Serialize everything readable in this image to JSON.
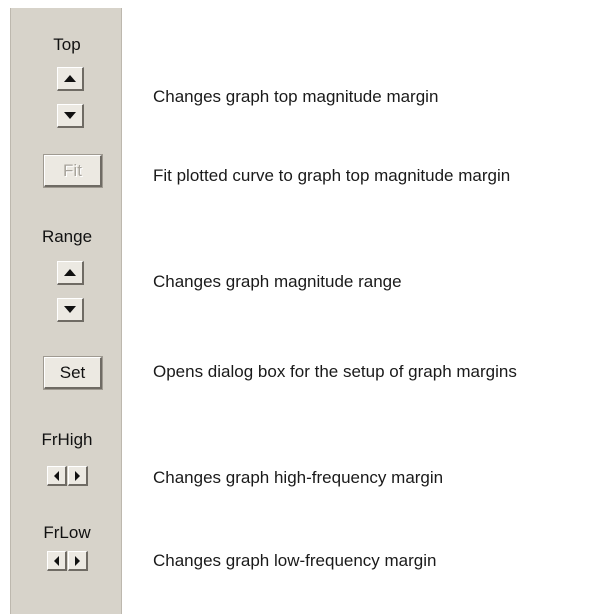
{
  "panel": {
    "top_label": "Top",
    "fit_label": "Fit",
    "range_label": "Range",
    "set_label": "Set",
    "frhigh_label": "FrHigh",
    "frlow_label": "FrLow"
  },
  "descriptions": {
    "top": "Changes graph top magnitude margin",
    "fit": "Fit plotted curve to graph top magnitude margin",
    "range": "Changes  graph magnitude range",
    "set": "Opens dialog box for the setup of graph margins",
    "frhigh": "Changes  graph high-frequency margin",
    "frlow": "Changes graph low-frequency margin"
  },
  "colors": {
    "panel_bg": "#d7d3ca",
    "button_face": "#ece9e2",
    "disabled_text": "#a8a49c"
  }
}
